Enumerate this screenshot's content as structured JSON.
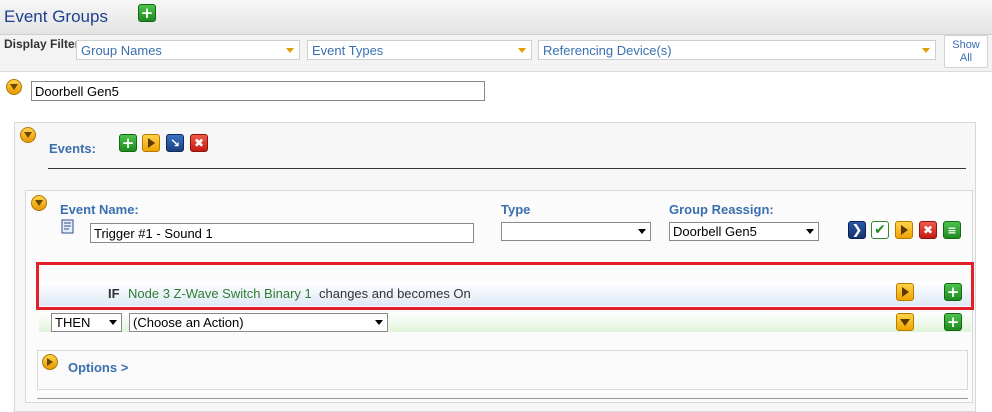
{
  "header": {
    "title": "Event Groups"
  },
  "filters": {
    "label": "Display Filters:",
    "group_names": "Group Names",
    "event_types": "Event Types",
    "referencing": "Referencing Device(s)",
    "show_all": "Show All"
  },
  "group": {
    "name_value": "Doorbell Gen5"
  },
  "events_section": {
    "label": "Events:"
  },
  "event": {
    "name_label": "Event Name:",
    "name_value": "Trigger #1 - Sound 1",
    "type_label": "Type",
    "type_value": "",
    "reassign_label": "Group Reassign:",
    "reassign_value": "Doorbell Gen5"
  },
  "condition": {
    "keyword": "IF",
    "device": "Node 3 Z-Wave Switch Binary 1",
    "text": "changes and becomes On"
  },
  "action": {
    "keyword": "THEN",
    "placeholder": "(Choose an Action)"
  },
  "options": {
    "label": "Options >"
  },
  "colors": {
    "highlight_border": "#e3202a",
    "accent_blue": "#3a6fb0",
    "device_green": "#2e7d32"
  }
}
